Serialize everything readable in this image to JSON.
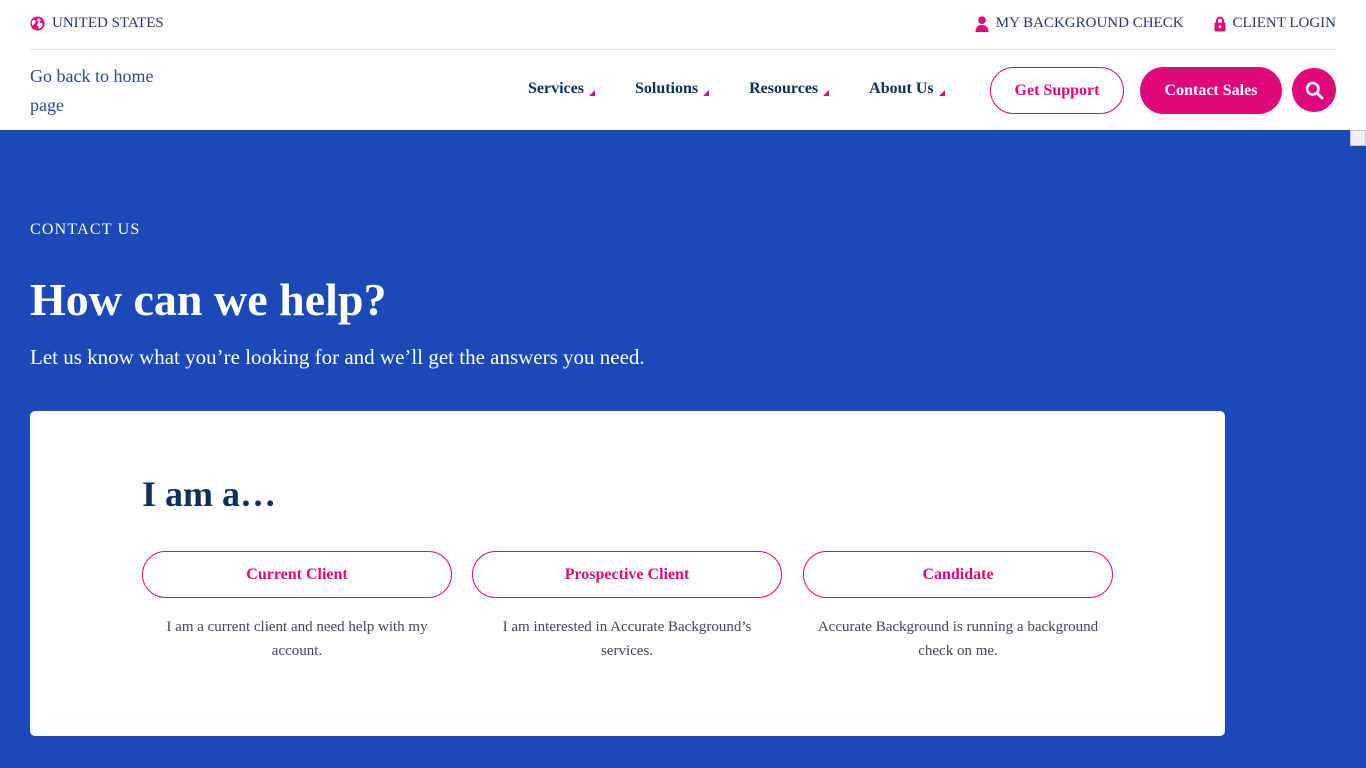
{
  "utility": {
    "region": "UNITED STATES",
    "background_check": "MY BACKGROUND CHECK",
    "client_login": "CLIENT LOGIN"
  },
  "logo": {
    "alt": "Go back to home page"
  },
  "nav": {
    "services": "Services",
    "solutions": "Solutions",
    "resources": "Resources",
    "about": "About Us"
  },
  "header_buttons": {
    "support": "Get Support",
    "sales": "Contact Sales"
  },
  "hero": {
    "eyebrow": "CONTACT US",
    "title": "How can we help?",
    "subtitle": "Let us know what you’re looking for and we’ll get the answers you need."
  },
  "chooser": {
    "title": "I am a…",
    "options": [
      {
        "label": "Current Client",
        "description": "I am a current client and need help with my account."
      },
      {
        "label": "Prospective Client",
        "description": "I am interested in Accurate Background’s services."
      },
      {
        "label": "Candidate",
        "description": "Accurate Background is running a background check on me."
      }
    ]
  },
  "colors": {
    "brand_pink": "#e0077d",
    "hero_blue": "#1b49b9",
    "navy_text": "#0e2f5c"
  },
  "icons": [
    "globe-icon",
    "user-icon",
    "lock-icon",
    "search-icon",
    "caret-icon"
  ]
}
